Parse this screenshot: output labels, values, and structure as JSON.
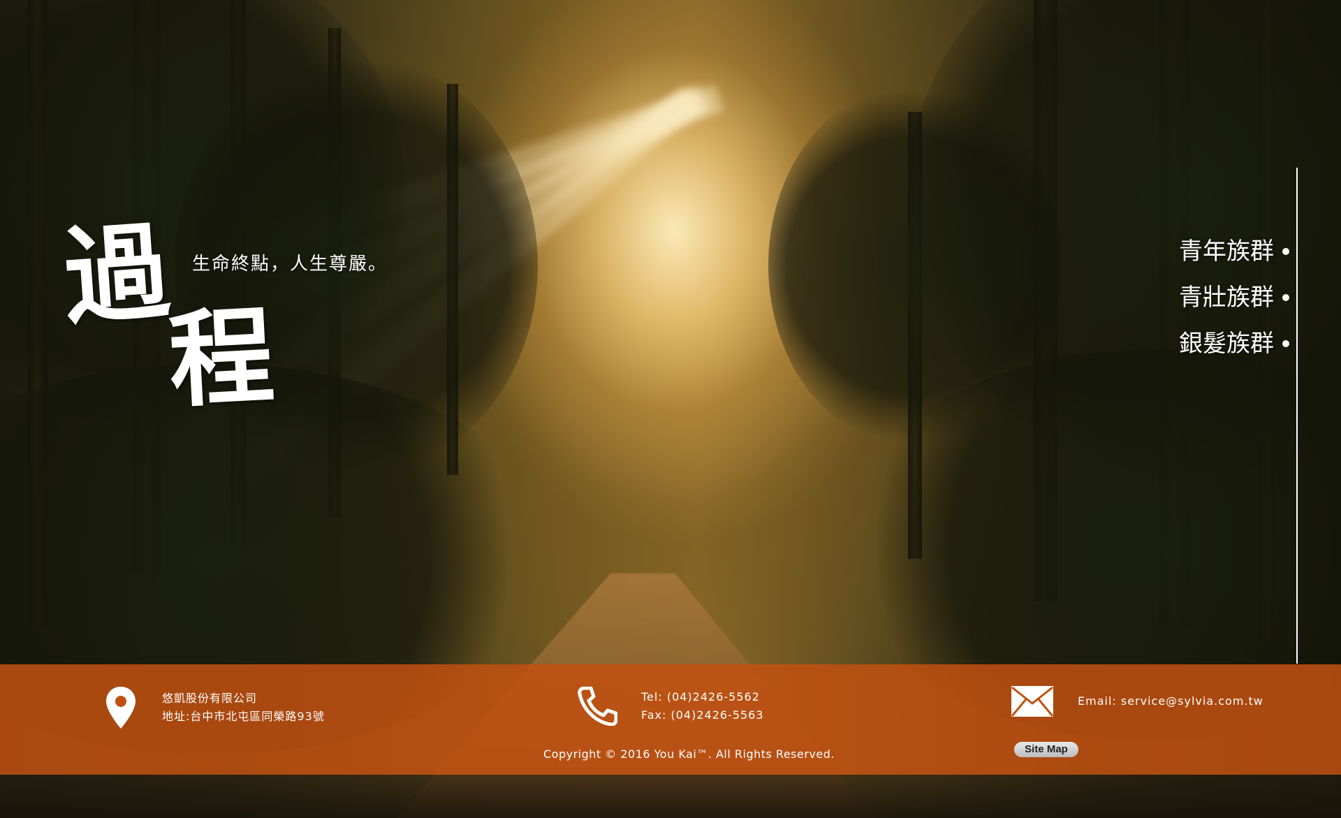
{
  "hero": {
    "logo_char_1": "過",
    "logo_char_2": "程",
    "tagline": "生命終點，人生尊嚴。"
  },
  "nav": {
    "items": [
      {
        "label": "青年族群"
      },
      {
        "label": "青壯族群"
      },
      {
        "label": "銀髮族群"
      }
    ]
  },
  "footer": {
    "company": "悠凱股份有限公司",
    "address": "地址:台中市北屯區同榮路93號",
    "tel": "Tel: (04)2426-5562",
    "fax": "Fax: (04)2426-5563",
    "email": "Email: service@sylvia.com.tw",
    "copyright": "Copyright © 2016 You Kai™. All Rights Reserved.",
    "sitemap_label": "Site Map",
    "icons": {
      "address": "location-pin-icon",
      "phone": "phone-icon",
      "email": "mail-icon"
    },
    "bar_color": "#c15010"
  }
}
